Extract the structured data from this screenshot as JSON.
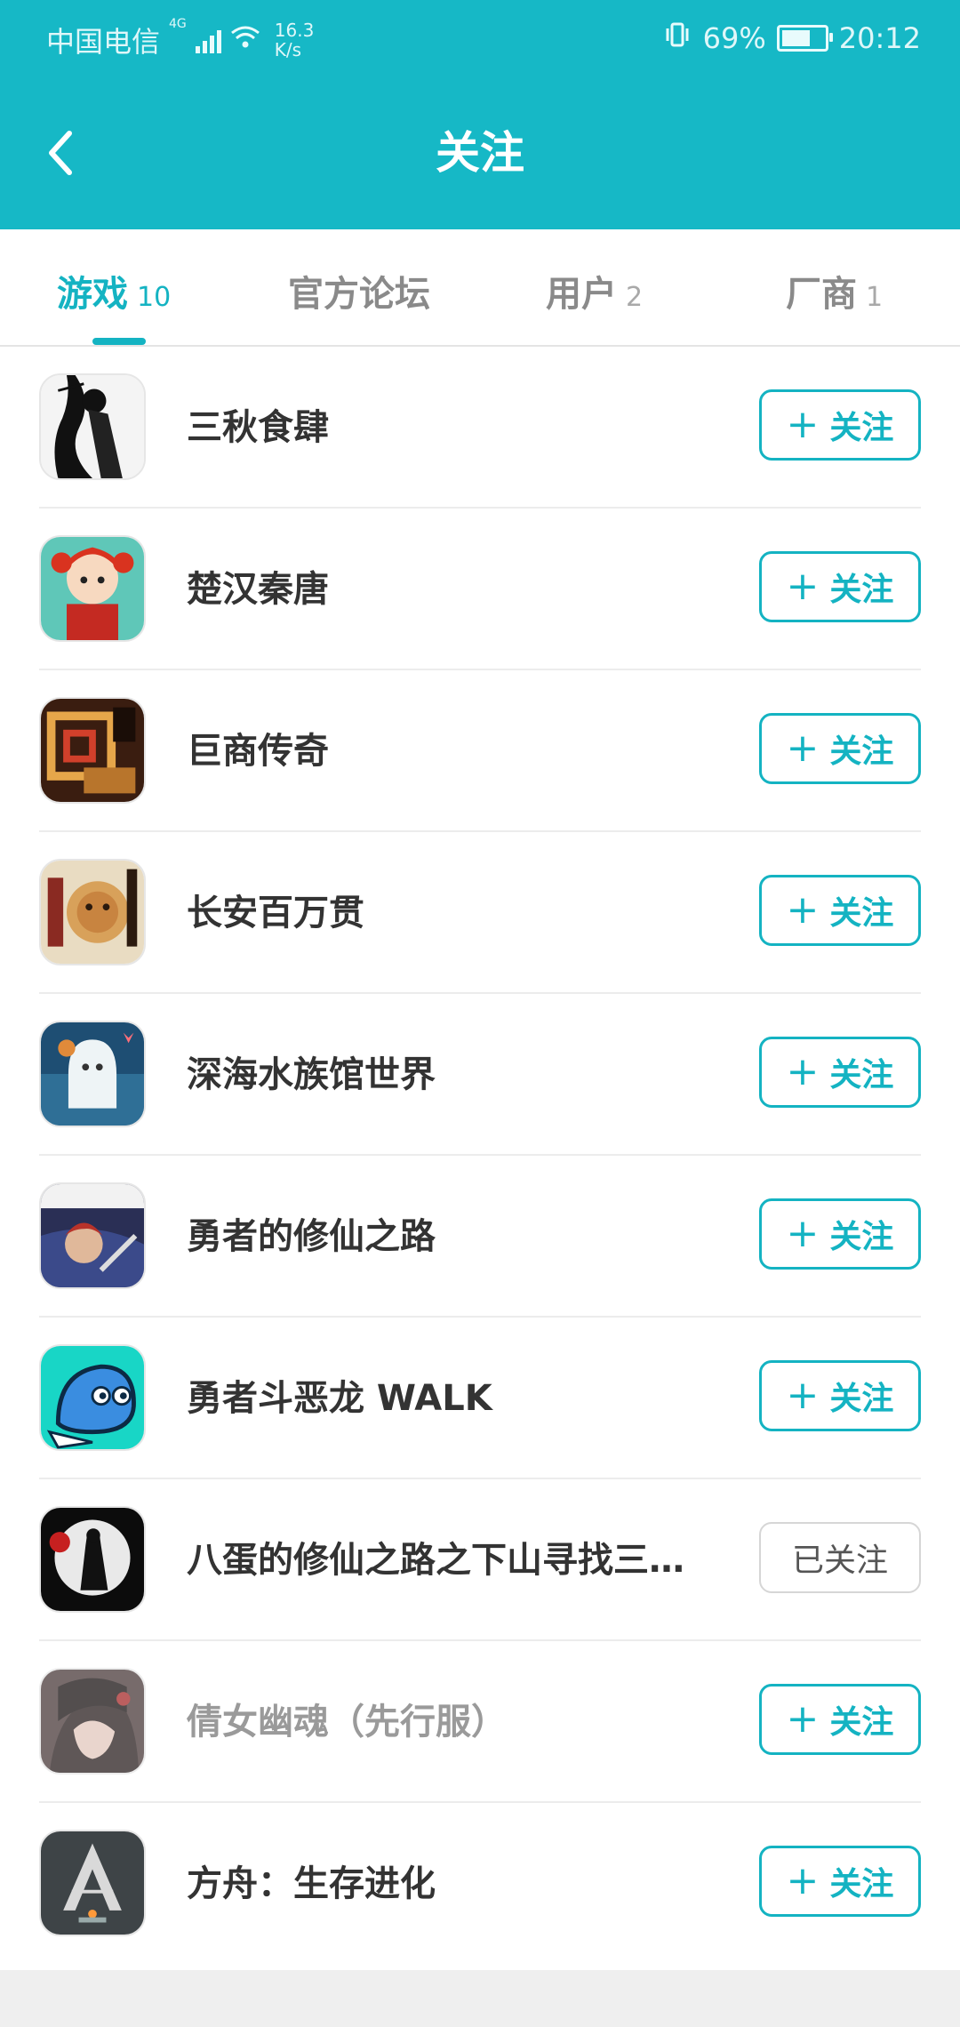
{
  "status_bar": {
    "carrier": "中国电信",
    "network": "4G",
    "speed_value": "16.3",
    "speed_unit": "K/s",
    "battery": "69%",
    "time": "20:12"
  },
  "header": {
    "title": "关注",
    "back_icon": "chevron-left-icon"
  },
  "tabs": [
    {
      "label": "游戏",
      "count": "10",
      "active": true
    },
    {
      "label": "官方论坛",
      "count": ""
    },
    {
      "label": "用户",
      "count": "2"
    },
    {
      "label": "厂商",
      "count": "1"
    }
  ],
  "follow_button": {
    "plus": "+",
    "label": "关注",
    "followed_label": "已关注"
  },
  "games": [
    {
      "name": "三秋食肆",
      "followed": false,
      "icon": "sanqiu-icon"
    },
    {
      "name": "楚汉秦唐",
      "followed": false,
      "icon": "chuhan-icon"
    },
    {
      "name": "巨商传奇",
      "followed": false,
      "icon": "jushang-icon"
    },
    {
      "name": "长安百万贯",
      "followed": false,
      "icon": "changan-icon"
    },
    {
      "name": "深海水族馆世界",
      "followed": false,
      "icon": "aquarium-icon"
    },
    {
      "name": "勇者的修仙之路",
      "followed": false,
      "icon": "hero-cultivation-icon"
    },
    {
      "name": "勇者斗恶龙 WALK",
      "followed": false,
      "icon": "dragon-quest-walk-icon"
    },
    {
      "name": "八蛋的修仙之路之下山寻找三…",
      "followed": true,
      "icon": "badan-icon"
    },
    {
      "name": "倩女幽魂（先行服）",
      "followed": false,
      "icon": "qiannv-icon"
    },
    {
      "name": "方舟：生存进化",
      "followed": false,
      "icon": "ark-icon"
    }
  ],
  "colors": {
    "accent": "#14b3c2",
    "header_bg": "#16b8c6"
  }
}
